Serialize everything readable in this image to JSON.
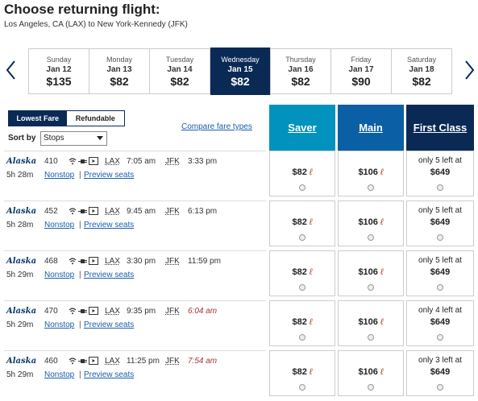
{
  "header": {
    "title": "Choose returning flight:",
    "route": "Los Angeles, CA (LAX) to New York-Kennedy (JFK)"
  },
  "dates": [
    {
      "dow": "Sunday",
      "md": "Jan 12",
      "price": "$135",
      "selected": false
    },
    {
      "dow": "Monday",
      "md": "Jan 13",
      "price": "$82",
      "selected": false
    },
    {
      "dow": "Tuesday",
      "md": "Jan 14",
      "price": "$82",
      "selected": false
    },
    {
      "dow": "Wednesday",
      "md": "Jan 15",
      "price": "$82",
      "selected": true
    },
    {
      "dow": "Thursday",
      "md": "Jan 16",
      "price": "$82",
      "selected": false
    },
    {
      "dow": "Friday",
      "md": "Jan 17",
      "price": "$90",
      "selected": false
    },
    {
      "dow": "Saturday",
      "md": "Jan 18",
      "price": "$82",
      "selected": false
    }
  ],
  "controls": {
    "lowest_fare": "Lowest Fare",
    "refundable": "Refundable",
    "sort_label": "Sort by",
    "sort_value": "Stops",
    "compare_link": "Compare fare types"
  },
  "cabins": {
    "saver": "Saver",
    "main": "Main",
    "first": "First Class"
  },
  "colors": {
    "navy": "#0a2a55",
    "saver": "#0193bd",
    "main": "#0b5fa5",
    "link": "#1a5ea8",
    "miles": "#c0392b"
  },
  "flights": [
    {
      "airline": "Alaska",
      "number": "410",
      "dep_code": "LAX",
      "dep_time": "7:05 am",
      "arr_code": "JFK",
      "arr_time": "3:33 pm",
      "next_day": false,
      "duration": "5h 28m",
      "stops": "Nonstop",
      "preview": "Preview seats",
      "saver": "$82",
      "main": "$106",
      "first_left": "only 5 left at",
      "first": "$649"
    },
    {
      "airline": "Alaska",
      "number": "452",
      "dep_code": "LAX",
      "dep_time": "9:45 am",
      "arr_code": "JFK",
      "arr_time": "6:13 pm",
      "next_day": false,
      "duration": "5h 28m",
      "stops": "Nonstop",
      "preview": "Preview seats",
      "saver": "$82",
      "main": "$106",
      "first_left": "only 5 left at",
      "first": "$649"
    },
    {
      "airline": "Alaska",
      "number": "468",
      "dep_code": "LAX",
      "dep_time": "3:30 pm",
      "arr_code": "JFK",
      "arr_time": "11:59 pm",
      "next_day": false,
      "duration": "5h 29m",
      "stops": "Nonstop",
      "preview": "Preview seats",
      "saver": "$82",
      "main": "$106",
      "first_left": "only 5 left at",
      "first": "$649"
    },
    {
      "airline": "Alaska",
      "number": "470",
      "dep_code": "LAX",
      "dep_time": "9:35 pm",
      "arr_code": "JFK",
      "arr_time": "6:04 am",
      "next_day": true,
      "duration": "5h 29m",
      "stops": "Nonstop",
      "preview": "Preview seats",
      "saver": "$82",
      "main": "$106",
      "first_left": "only 4 left at",
      "first": "$649"
    },
    {
      "airline": "Alaska",
      "number": "460",
      "dep_code": "LAX",
      "dep_time": "11:25 pm",
      "arr_code": "JFK",
      "arr_time": "7:54 am",
      "next_day": true,
      "duration": "5h 29m",
      "stops": "Nonstop",
      "preview": "Preview seats",
      "saver": "$82",
      "main": "$106",
      "first_left": "only 3 left at",
      "first": "$649"
    }
  ]
}
